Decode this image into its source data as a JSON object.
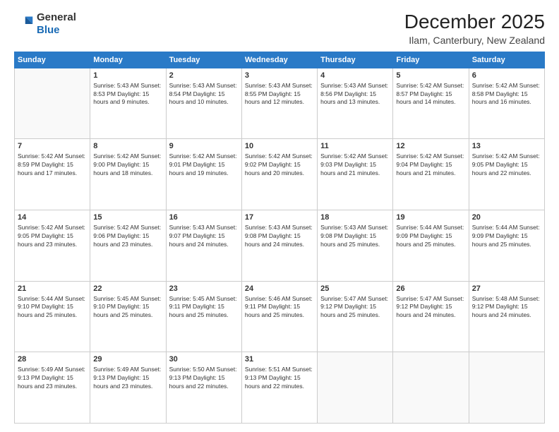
{
  "header": {
    "logo_line1": "General",
    "logo_line2": "Blue",
    "title": "December 2025",
    "subtitle": "Ilam, Canterbury, New Zealand"
  },
  "calendar": {
    "days_of_week": [
      "Sunday",
      "Monday",
      "Tuesday",
      "Wednesday",
      "Thursday",
      "Friday",
      "Saturday"
    ],
    "weeks": [
      [
        {
          "day": "",
          "info": ""
        },
        {
          "day": "1",
          "info": "Sunrise: 5:43 AM\nSunset: 8:53 PM\nDaylight: 15 hours\nand 9 minutes."
        },
        {
          "day": "2",
          "info": "Sunrise: 5:43 AM\nSunset: 8:54 PM\nDaylight: 15 hours\nand 10 minutes."
        },
        {
          "day": "3",
          "info": "Sunrise: 5:43 AM\nSunset: 8:55 PM\nDaylight: 15 hours\nand 12 minutes."
        },
        {
          "day": "4",
          "info": "Sunrise: 5:43 AM\nSunset: 8:56 PM\nDaylight: 15 hours\nand 13 minutes."
        },
        {
          "day": "5",
          "info": "Sunrise: 5:42 AM\nSunset: 8:57 PM\nDaylight: 15 hours\nand 14 minutes."
        },
        {
          "day": "6",
          "info": "Sunrise: 5:42 AM\nSunset: 8:58 PM\nDaylight: 15 hours\nand 16 minutes."
        }
      ],
      [
        {
          "day": "7",
          "info": "Sunrise: 5:42 AM\nSunset: 8:59 PM\nDaylight: 15 hours\nand 17 minutes."
        },
        {
          "day": "8",
          "info": "Sunrise: 5:42 AM\nSunset: 9:00 PM\nDaylight: 15 hours\nand 18 minutes."
        },
        {
          "day": "9",
          "info": "Sunrise: 5:42 AM\nSunset: 9:01 PM\nDaylight: 15 hours\nand 19 minutes."
        },
        {
          "day": "10",
          "info": "Sunrise: 5:42 AM\nSunset: 9:02 PM\nDaylight: 15 hours\nand 20 minutes."
        },
        {
          "day": "11",
          "info": "Sunrise: 5:42 AM\nSunset: 9:03 PM\nDaylight: 15 hours\nand 21 minutes."
        },
        {
          "day": "12",
          "info": "Sunrise: 5:42 AM\nSunset: 9:04 PM\nDaylight: 15 hours\nand 21 minutes."
        },
        {
          "day": "13",
          "info": "Sunrise: 5:42 AM\nSunset: 9:05 PM\nDaylight: 15 hours\nand 22 minutes."
        }
      ],
      [
        {
          "day": "14",
          "info": "Sunrise: 5:42 AM\nSunset: 9:05 PM\nDaylight: 15 hours\nand 23 minutes."
        },
        {
          "day": "15",
          "info": "Sunrise: 5:42 AM\nSunset: 9:06 PM\nDaylight: 15 hours\nand 23 minutes."
        },
        {
          "day": "16",
          "info": "Sunrise: 5:43 AM\nSunset: 9:07 PM\nDaylight: 15 hours\nand 24 minutes."
        },
        {
          "day": "17",
          "info": "Sunrise: 5:43 AM\nSunset: 9:08 PM\nDaylight: 15 hours\nand 24 minutes."
        },
        {
          "day": "18",
          "info": "Sunrise: 5:43 AM\nSunset: 9:08 PM\nDaylight: 15 hours\nand 25 minutes."
        },
        {
          "day": "19",
          "info": "Sunrise: 5:44 AM\nSunset: 9:09 PM\nDaylight: 15 hours\nand 25 minutes."
        },
        {
          "day": "20",
          "info": "Sunrise: 5:44 AM\nSunset: 9:09 PM\nDaylight: 15 hours\nand 25 minutes."
        }
      ],
      [
        {
          "day": "21",
          "info": "Sunrise: 5:44 AM\nSunset: 9:10 PM\nDaylight: 15 hours\nand 25 minutes."
        },
        {
          "day": "22",
          "info": "Sunrise: 5:45 AM\nSunset: 9:10 PM\nDaylight: 15 hours\nand 25 minutes."
        },
        {
          "day": "23",
          "info": "Sunrise: 5:45 AM\nSunset: 9:11 PM\nDaylight: 15 hours\nand 25 minutes."
        },
        {
          "day": "24",
          "info": "Sunrise: 5:46 AM\nSunset: 9:11 PM\nDaylight: 15 hours\nand 25 minutes."
        },
        {
          "day": "25",
          "info": "Sunrise: 5:47 AM\nSunset: 9:12 PM\nDaylight: 15 hours\nand 25 minutes."
        },
        {
          "day": "26",
          "info": "Sunrise: 5:47 AM\nSunset: 9:12 PM\nDaylight: 15 hours\nand 24 minutes."
        },
        {
          "day": "27",
          "info": "Sunrise: 5:48 AM\nSunset: 9:12 PM\nDaylight: 15 hours\nand 24 minutes."
        }
      ],
      [
        {
          "day": "28",
          "info": "Sunrise: 5:49 AM\nSunset: 9:13 PM\nDaylight: 15 hours\nand 23 minutes."
        },
        {
          "day": "29",
          "info": "Sunrise: 5:49 AM\nSunset: 9:13 PM\nDaylight: 15 hours\nand 23 minutes."
        },
        {
          "day": "30",
          "info": "Sunrise: 5:50 AM\nSunset: 9:13 PM\nDaylight: 15 hours\nand 22 minutes."
        },
        {
          "day": "31",
          "info": "Sunrise: 5:51 AM\nSunset: 9:13 PM\nDaylight: 15 hours\nand 22 minutes."
        },
        {
          "day": "",
          "info": ""
        },
        {
          "day": "",
          "info": ""
        },
        {
          "day": "",
          "info": ""
        }
      ]
    ]
  }
}
